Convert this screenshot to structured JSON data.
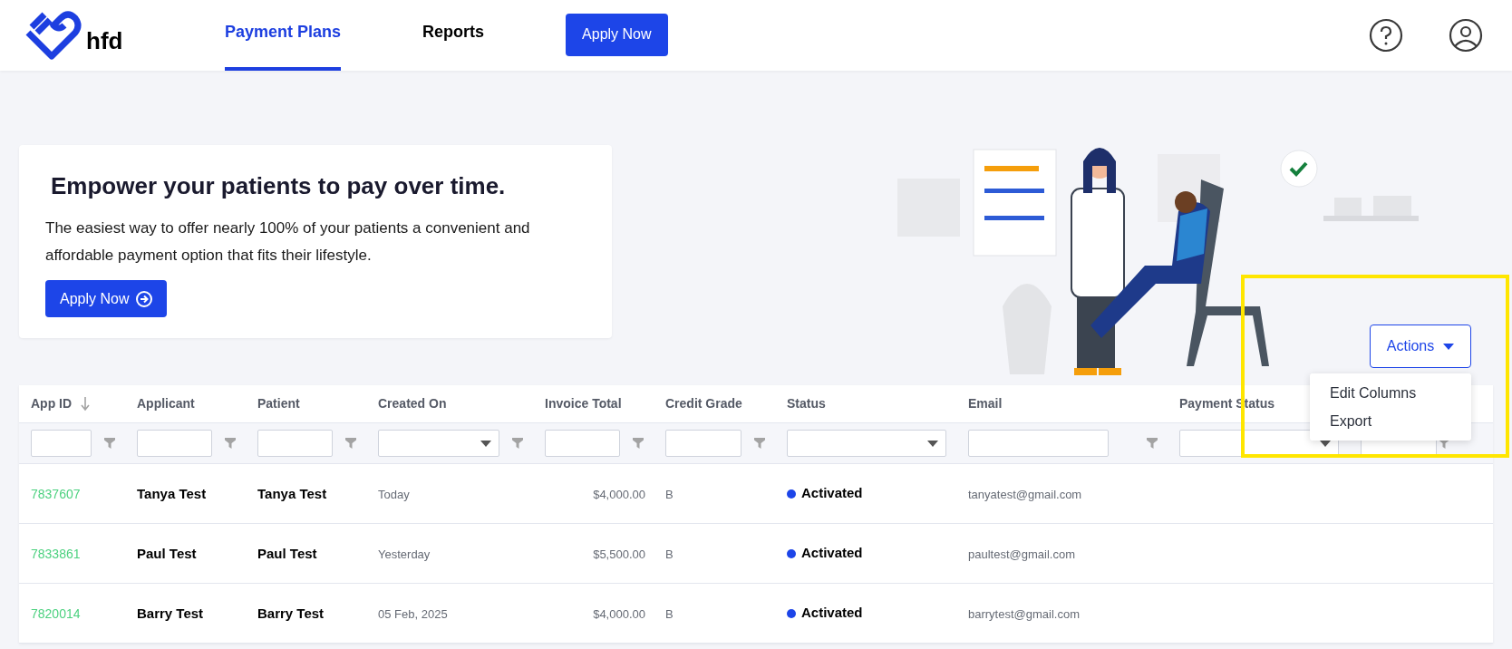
{
  "nav": {
    "brand": "hfd",
    "tabs": [
      {
        "label": "Payment Plans",
        "selected": true
      },
      {
        "label": "Reports",
        "selected": false
      }
    ],
    "apply_button": "Apply Now"
  },
  "hero": {
    "title": "Empower your patients to pay over time.",
    "text": "The easiest way to offer nearly 100% of your patients a convenient and affordable payment option that fits their lifestyle.",
    "button": "Apply Now"
  },
  "actions": {
    "label": "Actions",
    "expanded": true,
    "menu": [
      "Edit Columns",
      "Export"
    ]
  },
  "table": {
    "columns": [
      {
        "label": "App ID",
        "sorted": true,
        "kind": "text",
        "funnel": true
      },
      {
        "label": "Applicant",
        "sorted": false,
        "kind": "text",
        "funnel": true
      },
      {
        "label": "Patient",
        "sorted": false,
        "kind": "text",
        "funnel": true
      },
      {
        "label": "Created On",
        "sorted": false,
        "kind": "select",
        "funnel": true
      },
      {
        "label": "Invoice Total",
        "sorted": false,
        "kind": "text",
        "funnel": true
      },
      {
        "label": "Credit Grade",
        "sorted": false,
        "kind": "text",
        "funnel": true
      },
      {
        "label": "Status",
        "sorted": false,
        "kind": "select",
        "funnel": false
      },
      {
        "label": "Email",
        "sorted": false,
        "kind": "text",
        "funnel": true
      },
      {
        "label": "Payment Status",
        "sorted": false,
        "kind": "select",
        "funnel": false
      },
      {
        "sorted": false,
        "kind": "text",
        "funnel": true
      }
    ],
    "rows": [
      {
        "app_id": "7837607",
        "applicant": "Tanya Test",
        "patient": "Tanya Test",
        "created_on": "Today",
        "invoice_total": "$4,000.00",
        "credit_grade": "B",
        "status": "Activated",
        "email": "tanyatest@gmail.com"
      },
      {
        "app_id": "7833861",
        "applicant": "Paul Test",
        "patient": "Paul Test",
        "created_on": "Yesterday",
        "invoice_total": "$5,500.00",
        "credit_grade": "B",
        "status": "Activated",
        "email": "paultest@gmail.com"
      },
      {
        "app_id": "7820014",
        "applicant": "Barry Test",
        "patient": "Barry Test",
        "created_on": "05 Feb, 2025",
        "invoice_total": "$4,000.00",
        "credit_grade": "B",
        "status": "Activated",
        "email": "barrytest@gmail.com"
      }
    ]
  }
}
